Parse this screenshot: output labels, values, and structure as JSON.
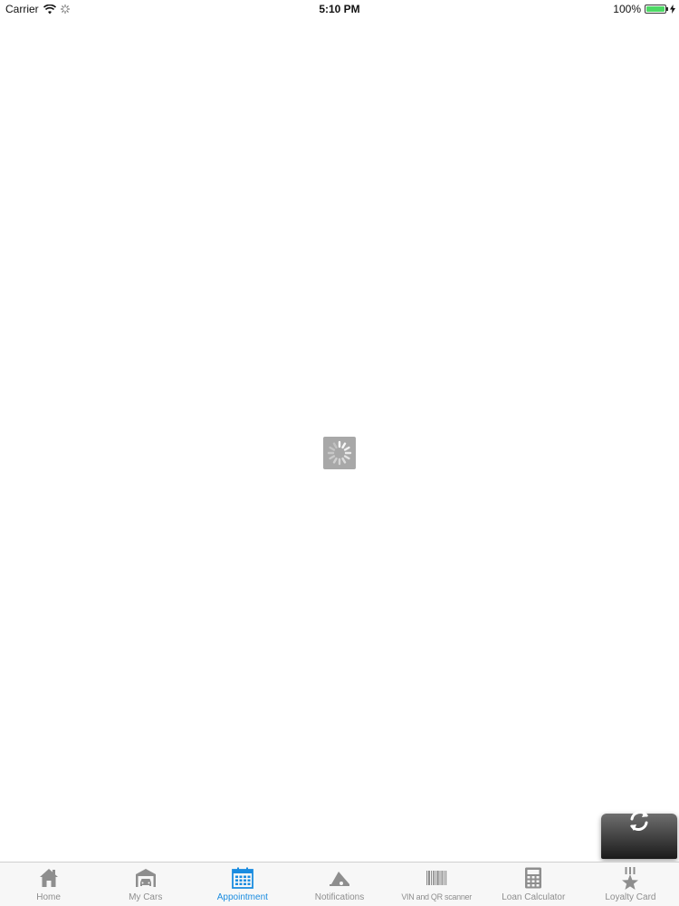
{
  "status_bar": {
    "carrier": "Carrier",
    "time": "5:10 PM",
    "battery": "100%"
  },
  "tabs": [
    {
      "label": "Home",
      "icon": "home-icon",
      "active": false
    },
    {
      "label": "My Cars",
      "icon": "garage-icon",
      "active": false
    },
    {
      "label": "Appointment",
      "icon": "calendar-icon",
      "active": true
    },
    {
      "label": "Notifications",
      "icon": "megaphone-icon",
      "active": false
    },
    {
      "label": "VIN and QR scanner",
      "icon": "barcode-icon",
      "active": false
    },
    {
      "label": "Loan Calculator",
      "icon": "calculator-icon",
      "active": false
    },
    {
      "label": "Loyalty Card",
      "icon": "medal-icon",
      "active": false
    }
  ],
  "colors": {
    "active_tab": "#1a8ce0",
    "inactive_tab": "#8e8e8e",
    "battery": "#4cd964"
  }
}
